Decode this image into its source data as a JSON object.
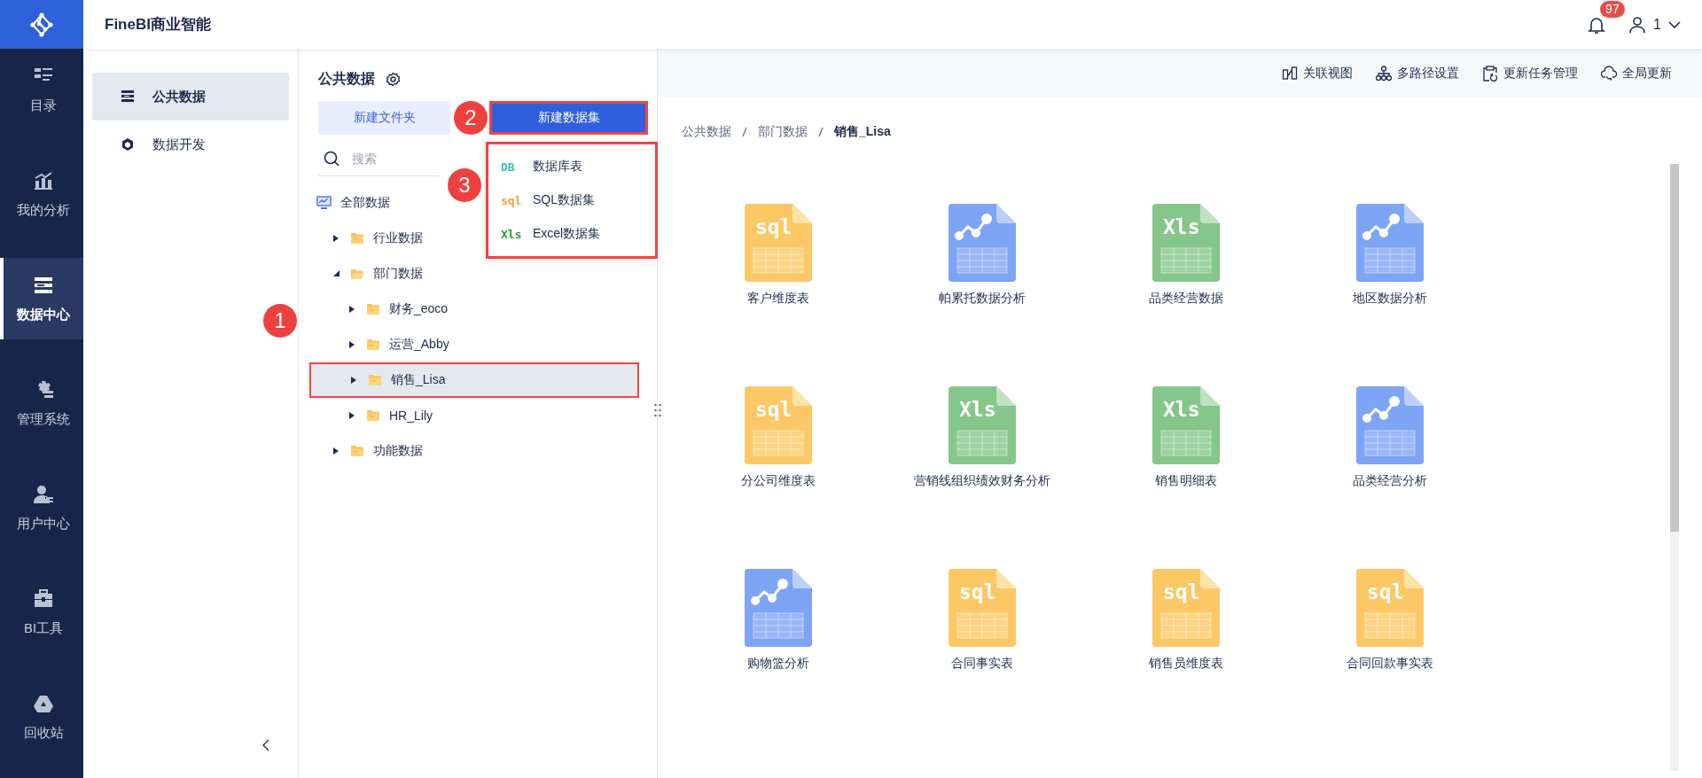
{
  "app": {
    "title": "FineBI商业智能",
    "notifications": "97",
    "user": "1"
  },
  "nav": [
    {
      "label": "目录",
      "kind": "catalog",
      "selected": false
    },
    {
      "label": "我的分析",
      "kind": "analysis",
      "selected": false
    },
    {
      "label": "数据中心",
      "kind": "data",
      "selected": true
    },
    {
      "label": "管理系统",
      "kind": "admin",
      "selected": false
    },
    {
      "label": "用户中心",
      "kind": "user",
      "selected": false
    },
    {
      "label": "BI工具",
      "kind": "tools",
      "selected": false
    },
    {
      "label": "回收站",
      "kind": "recycle",
      "selected": false
    }
  ],
  "subnav": [
    {
      "label": "公共数据",
      "kind": "public",
      "selected": true
    },
    {
      "label": "数据开发",
      "kind": "develop",
      "selected": false
    }
  ],
  "panel": {
    "title": "公共数据",
    "new_folder": {
      "label": "新建文件夹"
    },
    "new_dataset": {
      "label": "新建数据集",
      "highlighted": true,
      "step": "2"
    },
    "search": {
      "placeholder": "搜索"
    },
    "menu": {
      "highlighted": true,
      "step": "3",
      "items": [
        {
          "label": "数据库表",
          "kind": "db",
          "glyph": "DB"
        },
        {
          "label": "SQL数据集",
          "kind": "sql",
          "glyph": "sql"
        },
        {
          "label": "Excel数据集",
          "kind": "xls",
          "glyph": "Xls"
        }
      ]
    },
    "tree": [
      {
        "label": "全部数据",
        "kind": "root",
        "selected": false,
        "children": [
          {
            "label": "行业数据",
            "kind": "folder",
            "expanded": false,
            "selected": false
          },
          {
            "label": "部门数据",
            "kind": "folder",
            "expanded": true,
            "selected": false,
            "children": [
              {
                "label": "财务_eoco",
                "kind": "folder",
                "expanded": false,
                "selected": false
              },
              {
                "label": "运营_Abby",
                "kind": "folder",
                "expanded": false,
                "selected": false
              },
              {
                "label": "销售_Lisa",
                "kind": "folder",
                "expanded": false,
                "selected": true,
                "highlighted": true,
                "step": "1"
              },
              {
                "label": "HR_Lily",
                "kind": "folder",
                "expanded": false,
                "selected": false
              }
            ]
          },
          {
            "label": "功能数据",
            "kind": "folder",
            "expanded": false,
            "selected": false
          }
        ]
      }
    ]
  },
  "toolbar": [
    {
      "label": "关联视图",
      "kind": "relation"
    },
    {
      "label": "多路径设置",
      "kind": "paths"
    },
    {
      "label": "更新任务管理",
      "kind": "tasks"
    },
    {
      "label": "全局更新",
      "kind": "update"
    }
  ],
  "breadcrumb": [
    "公共数据",
    "部门数据",
    "销售_Lisa"
  ],
  "datasets": [
    {
      "name": "客户维度表",
      "kind": "sql",
      "glyph": "sql"
    },
    {
      "name": "帕累托数据分析",
      "kind": "analysis"
    },
    {
      "name": "品类经营数据",
      "kind": "xls",
      "glyph": "Xls"
    },
    {
      "name": "地区数据分析",
      "kind": "analysis"
    },
    {
      "name": "分公司维度表",
      "kind": "sql",
      "glyph": "sql"
    },
    {
      "name": "营销线组织绩效财务分析",
      "kind": "xls",
      "glyph": "Xls"
    },
    {
      "name": "销售明细表",
      "kind": "xls",
      "glyph": "Xls"
    },
    {
      "name": "品类经营分析",
      "kind": "analysis"
    },
    {
      "name": "购物篮分析",
      "kind": "analysis"
    },
    {
      "name": "合同事实表",
      "kind": "sql",
      "glyph": "sql"
    },
    {
      "name": "销售员维度表",
      "kind": "sql",
      "glyph": "sql"
    },
    {
      "name": "合同回款事实表",
      "kind": "sql",
      "glyph": "sql"
    }
  ]
}
